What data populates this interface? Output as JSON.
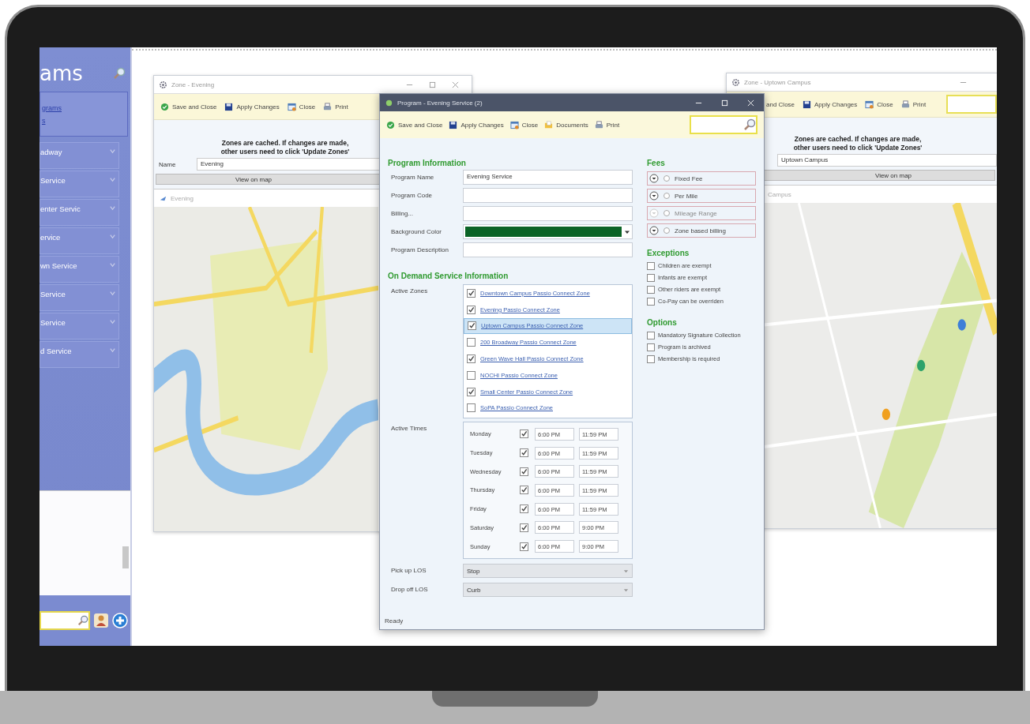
{
  "sidebar": {
    "title": "ams",
    "links": [
      "grams",
      "s"
    ],
    "items": [
      "adway",
      "Service",
      "enter Servic",
      "ervice",
      "wn Service",
      "Service",
      "Service",
      "d Service"
    ]
  },
  "zone_windows": [
    {
      "title": "Zone - Evening",
      "toolbar": [
        {
          "label": "Save and Close",
          "kind": "save"
        },
        {
          "label": "Apply Changes",
          "kind": "apply"
        },
        {
          "label": "Close",
          "kind": "close"
        },
        {
          "label": "Print",
          "kind": "print"
        }
      ],
      "notice_lines": [
        "Zones are cached. If changes are made,",
        "other users need to click 'Update Zones'"
      ],
      "name_label": "Name",
      "name_value": "Evening",
      "map_button": "View on map",
      "map_title": "Evening"
    },
    {
      "title": "Zone - Uptown Campus",
      "toolbar": [
        {
          "label": "and Close",
          "kind": "none"
        },
        {
          "label": "Apply Changes",
          "kind": "apply"
        },
        {
          "label": "Close",
          "kind": "close"
        },
        {
          "label": "Print",
          "kind": "print"
        }
      ],
      "notice_lines": [
        "Zones are cached. If changes are made,",
        "other users need to click 'Update Zones'"
      ],
      "name_value": "Uptown Campus",
      "map_button": "View on map",
      "map_title": "Campus"
    }
  ],
  "program_window": {
    "title": "Program - Evening Service (2)",
    "toolbar": [
      {
        "label": "Save and Close",
        "kind": "save"
      },
      {
        "label": "Apply Changes",
        "kind": "apply"
      },
      {
        "label": "Close",
        "kind": "close"
      },
      {
        "label": "Documents",
        "kind": "documents"
      },
      {
        "label": "Print",
        "kind": "print"
      }
    ],
    "program_info": {
      "heading": "Program Information",
      "fields": [
        {
          "label": "Program Name",
          "kind": "text",
          "value": "Evening Service"
        },
        {
          "label": "Program Code",
          "kind": "text"
        },
        {
          "label": "Billing...",
          "kind": "text"
        },
        {
          "label": "Background Color",
          "kind": "color",
          "color": "#0b6326"
        },
        {
          "label": "Program Description",
          "kind": "text"
        }
      ]
    },
    "on_demand": {
      "heading": "On Demand Service Information",
      "zones_label": "Active Zones",
      "zones": [
        {
          "name": "Downtown Campus Passio Connect Zone",
          "checked": true,
          "selected": false
        },
        {
          "name": "Evening Passio Connect Zone",
          "checked": true,
          "selected": false
        },
        {
          "name": "Uptown Campus Passio Connect Zone",
          "checked": true,
          "selected": true
        },
        {
          "name": "200 Broadway Passio Connect Zone",
          "checked": false,
          "selected": false
        },
        {
          "name": "Green Wave Hall Passio Connect Zone",
          "checked": true,
          "selected": false
        },
        {
          "name": "NOCHI Passio Connect Zone",
          "checked": false,
          "selected": false
        },
        {
          "name": "Small Center Passio Connect Zone",
          "checked": true,
          "selected": false
        },
        {
          "name": "SoPA Passio Connect Zone",
          "checked": false,
          "selected": false
        }
      ],
      "times_label": "Active Times",
      "times": [
        {
          "day": "Monday",
          "checked": true,
          "start": "6:00 PM",
          "end": "11:59 PM"
        },
        {
          "day": "Tuesday",
          "checked": true,
          "start": "6:00 PM",
          "end": "11:59 PM"
        },
        {
          "day": "Wednesday",
          "checked": true,
          "start": "6:00 PM",
          "end": "11:59 PM"
        },
        {
          "day": "Thursday",
          "checked": true,
          "start": "6:00 PM",
          "end": "11:59 PM"
        },
        {
          "day": "Friday",
          "checked": true,
          "start": "6:00 PM",
          "end": "11:59 PM"
        },
        {
          "day": "Saturday",
          "checked": true,
          "start": "6:00 PM",
          "end": "9:00 PM"
        },
        {
          "day": "Sunday",
          "checked": true,
          "start": "6:00 PM",
          "end": "9:00 PM"
        }
      ],
      "los": [
        {
          "label": "Pick up LOS",
          "value": "Stop"
        },
        {
          "label": "Drop off LOS",
          "value": "Curb"
        }
      ]
    },
    "fees": {
      "heading": "Fees",
      "items": [
        {
          "label": "Fixed Fee",
          "selected": false,
          "disabled": false
        },
        {
          "label": "Per Mile",
          "selected": false,
          "disabled": false
        },
        {
          "label": "Mileage Range",
          "selected": false,
          "disabled": true
        },
        {
          "label": "Zone based billing",
          "selected": false,
          "disabled": false
        }
      ]
    },
    "exceptions": {
      "heading": "Exceptions",
      "items": [
        {
          "label": "Children are exempt",
          "checked": false
        },
        {
          "label": "Infants are exempt",
          "checked": false
        },
        {
          "label": "Other riders are exempt",
          "checked": false
        },
        {
          "label": "Co-Pay can be overriden",
          "checked": false
        }
      ]
    },
    "options": {
      "heading": "Options",
      "items": [
        {
          "label": "Mandatory Signature Collection",
          "checked": false
        },
        {
          "label": "Program is archived",
          "checked": false
        },
        {
          "label": "Membership is required",
          "checked": false
        }
      ]
    },
    "status": "Ready"
  }
}
